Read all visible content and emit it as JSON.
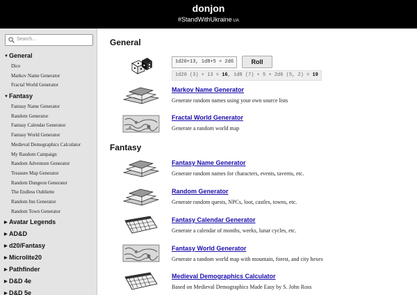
{
  "header": {
    "title": "donjon",
    "subtitle": "#StandWithUkraine",
    "subtitle_tag": "UA"
  },
  "search": {
    "placeholder": "Search..."
  },
  "sidebar": {
    "sections": [
      {
        "label": "General",
        "expanded": true,
        "items": [
          "Dice",
          "Markov Name Generator",
          "Fractal World Generator"
        ]
      },
      {
        "label": "Fantasy",
        "expanded": true,
        "items": [
          "Fantasy Name Generator",
          "Random Generator",
          "Fantasy Calendar Generator",
          "Fantasy World Generator",
          "Medieval Demographics Calculator",
          "My Random Campaign",
          "Random Adventure Generator",
          "Treasure Map Generator",
          "Random Dungeon Generator",
          "The Endless Oubliette",
          "Random Inn Generator",
          "Random Town Generator"
        ]
      },
      {
        "label": "Avatar Legends",
        "expanded": false,
        "items": []
      },
      {
        "label": "AD&D",
        "expanded": false,
        "items": []
      },
      {
        "label": "d20/Fantasy",
        "expanded": false,
        "items": []
      },
      {
        "label": "Microlite20",
        "expanded": false,
        "items": []
      },
      {
        "label": "Pathfinder",
        "expanded": false,
        "items": []
      },
      {
        "label": "D&D 4e",
        "expanded": false,
        "items": []
      },
      {
        "label": "D&D 5e",
        "expanded": false,
        "items": []
      }
    ]
  },
  "main": {
    "general_heading": "General",
    "fantasy_heading": "Fantasy",
    "dice": {
      "input_value": "1d20+13, 1d8+5 + 2d6",
      "roll_label": "Roll",
      "result_1_expr": "1d20 (3) + 13 = ",
      "result_1_total": "16",
      "result_sep": ", ",
      "result_2_expr": "1d8 (7) + 5 + 2d6 (5, 2) = ",
      "result_2_total": "19"
    },
    "tools": [
      {
        "title": "Markov Name Generator",
        "desc": "Generate random names using your own source lists"
      },
      {
        "title": "Fractal World Generator",
        "desc": "Generate a random world map"
      },
      {
        "title": "Fantasy Name Generator",
        "desc": "Generate random names for characters, events, taverns, etc."
      },
      {
        "title": "Random Generator",
        "desc": "Generate random quests, NPCs, loot, castles, towns, etc."
      },
      {
        "title": "Fantasy Calendar Generator",
        "desc": "Generate a calendar of months, weeks, lunar cycles, etc."
      },
      {
        "title": "Fantasy World Generator",
        "desc": "Generate a random world map with mountain, forest, and city hexes"
      },
      {
        "title": "Medieval Demographics Calculator",
        "desc": "Based on Medieval Demographics Made Easy by S. John Ross"
      }
    ]
  },
  "colors": {
    "header_bg": "#000000",
    "sidebar_bg": "#e4e4e4",
    "link": "#1a0dab"
  },
  "icons": [
    "search-icon",
    "dice-icon",
    "books-icon",
    "world-map-icon",
    "calendar-icon",
    "triangle-right-icon",
    "triangle-down-icon"
  ]
}
